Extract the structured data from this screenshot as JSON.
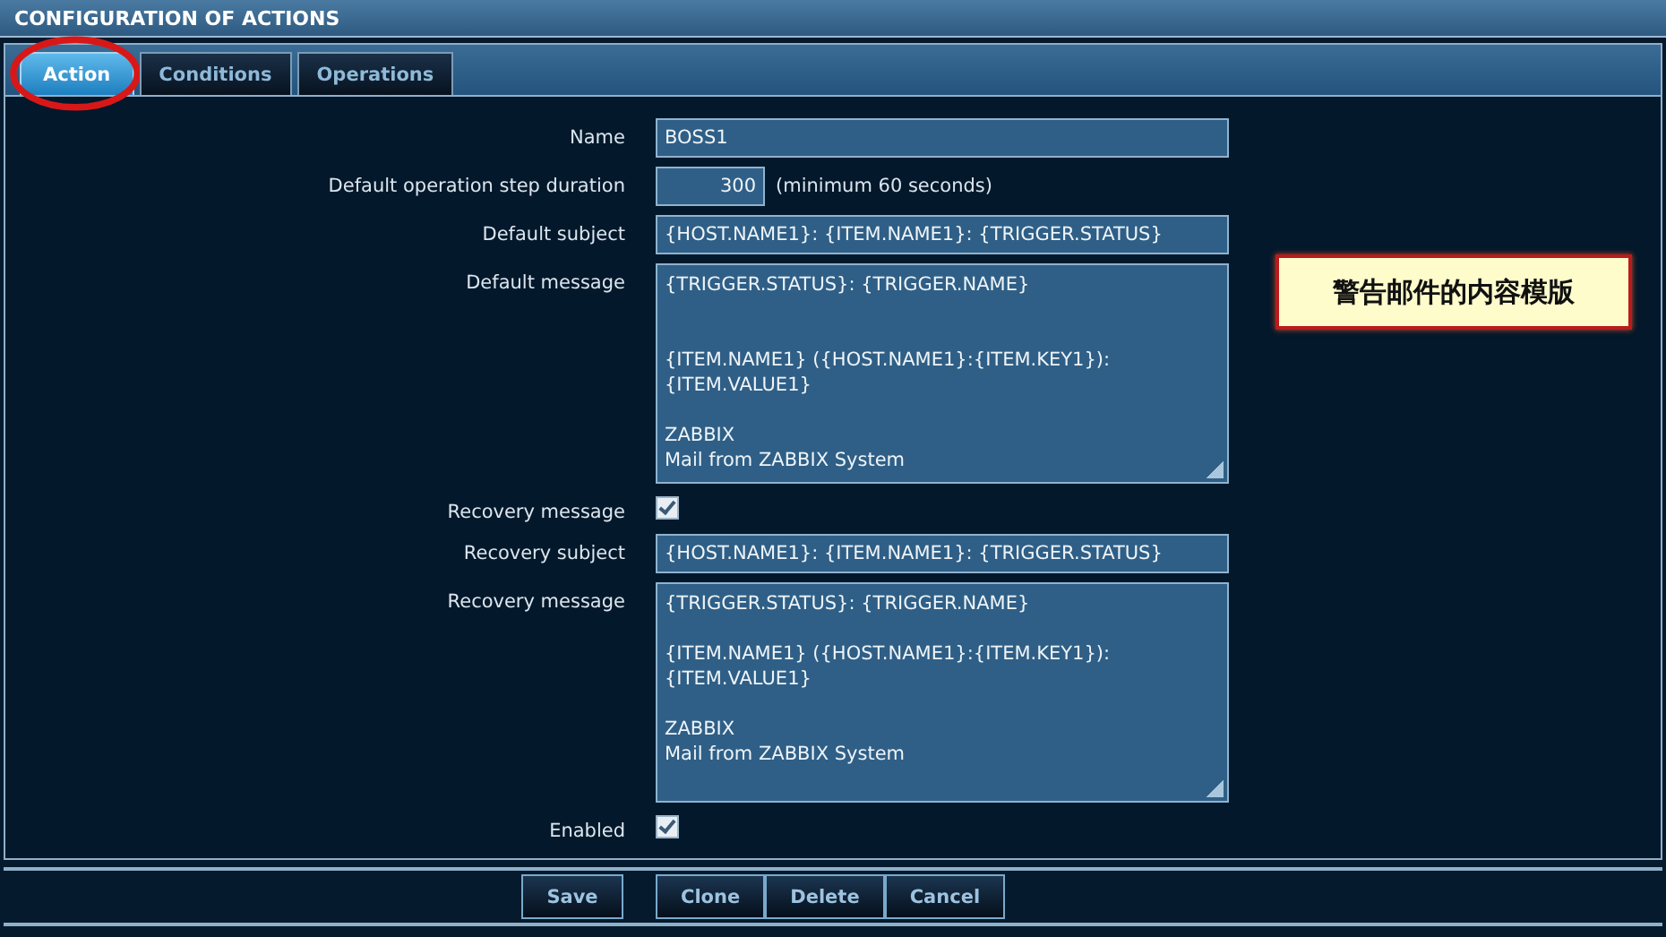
{
  "header": {
    "title": "CONFIGURATION OF ACTIONS"
  },
  "tabs": [
    {
      "label": "Action",
      "selected": true,
      "circled": true
    },
    {
      "label": "Conditions",
      "selected": false,
      "circled": false
    },
    {
      "label": "Operations",
      "selected": false,
      "circled": false
    }
  ],
  "fields": [
    {
      "kind": "text",
      "label": "Name",
      "value": "BOSS1"
    },
    {
      "kind": "number",
      "label": "Default operation step duration",
      "value": "300",
      "hint": "(minimum 60 seconds)"
    },
    {
      "kind": "text",
      "label": "Default subject",
      "value": "{HOST.NAME1}: {ITEM.NAME1}: {TRIGGER.STATUS}"
    },
    {
      "kind": "textarea",
      "label": "Default message",
      "value": "{TRIGGER.STATUS}: {TRIGGER.NAME}\n\n\n{ITEM.NAME1} ({HOST.NAME1}:{ITEM.KEY1}):\n{ITEM.VALUE1}\n\nZABBIX\nMail from ZABBIX System"
    },
    {
      "kind": "checkbox",
      "label": "Recovery message",
      "checked": true
    },
    {
      "kind": "text",
      "label": "Recovery subject",
      "value": "{HOST.NAME1}: {ITEM.NAME1}: {TRIGGER.STATUS}"
    },
    {
      "kind": "textarea",
      "label": "Recovery message",
      "value": "{TRIGGER.STATUS}: {TRIGGER.NAME}\n\n{ITEM.NAME1} ({HOST.NAME1}:{ITEM.KEY1}):\n{ITEM.VALUE1}\n\nZABBIX\nMail from ZABBIX System"
    },
    {
      "kind": "checkbox",
      "label": "Enabled",
      "checked": true
    }
  ],
  "callout": {
    "text": "警告邮件的内容模版"
  },
  "buttons": [
    {
      "label": "Save",
      "grouped": false
    },
    {
      "label": "Clone",
      "grouped": true
    },
    {
      "label": "Delete",
      "grouped": true
    },
    {
      "label": "Cancel",
      "grouped": true
    }
  ]
}
